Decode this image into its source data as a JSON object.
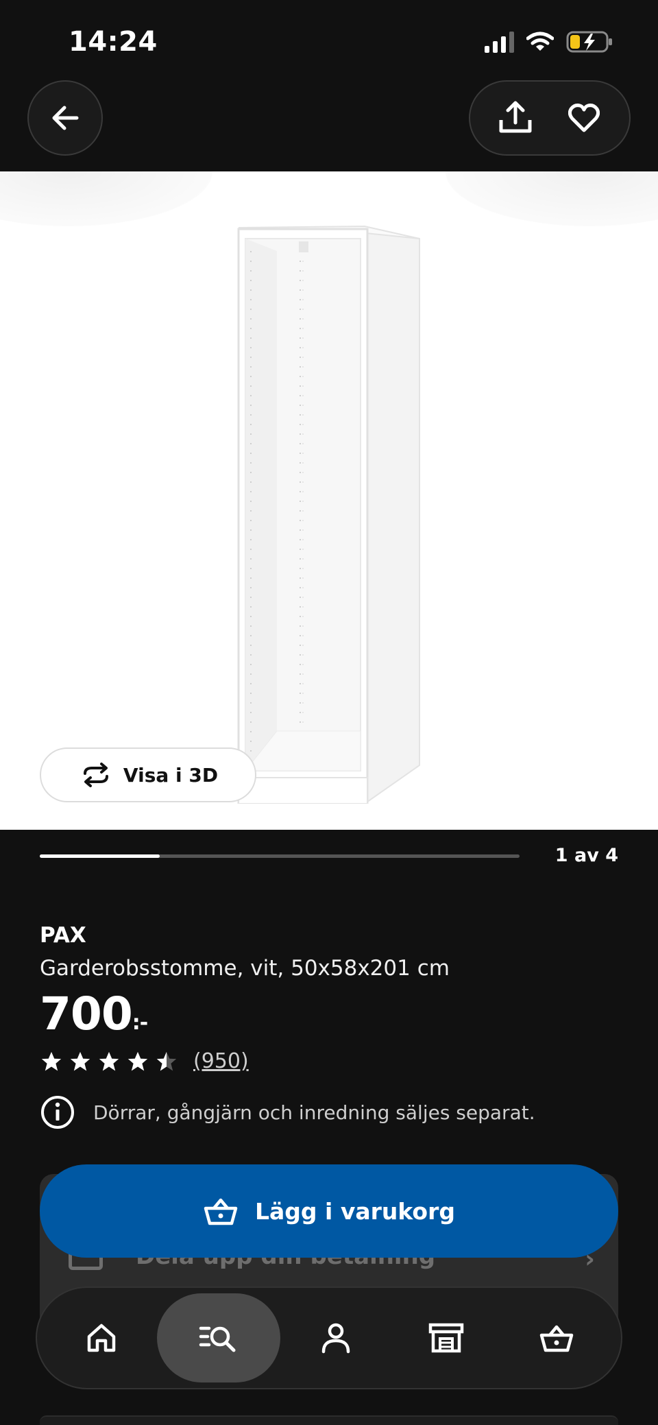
{
  "status_bar": {
    "time": "14:24",
    "battery_color": "#f5c518"
  },
  "header": {
    "back_icon": "arrow-left-icon",
    "share_icon": "share-icon",
    "favorite_icon": "heart-icon"
  },
  "gallery": {
    "view_3d_label": "Visa i 3D",
    "pager_label": "1 av 4",
    "current_index": 1,
    "total_images": 4
  },
  "product": {
    "brand": "PAX",
    "description": "Garderobsstomme, vit, 50x58x201 cm",
    "price": "700",
    "price_suffix": ":-",
    "rating_stars": 4.5,
    "rating_count": "(950)",
    "notice": "Dörrar, gångjärn och inredning säljes separat."
  },
  "actions": {
    "add_to_cart_label": "Lägg i varukorg",
    "pay_card_label": "Dela upp din betalning",
    "accent_color": "#0058a3"
  },
  "nav": {
    "items": [
      {
        "name": "home",
        "icon": "home-icon"
      },
      {
        "name": "search",
        "icon": "search-icon",
        "active": true
      },
      {
        "name": "profile",
        "icon": "user-icon"
      },
      {
        "name": "store",
        "icon": "store-icon"
      },
      {
        "name": "cart",
        "icon": "basket-icon"
      }
    ]
  }
}
